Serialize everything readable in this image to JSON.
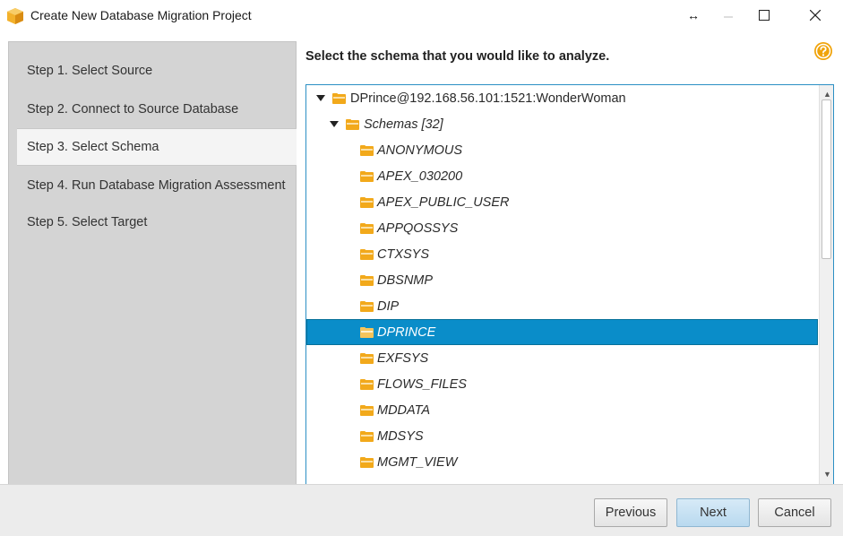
{
  "window": {
    "title": "Create New Database Migration Project",
    "resize_glyph": "↔",
    "app_icon": "cube-icon"
  },
  "steps": [
    {
      "label": "Step 1. Select Source",
      "active": false
    },
    {
      "label": "Step 2. Connect to Source Database",
      "active": false
    },
    {
      "label": "Step 3. Select Schema",
      "active": true
    },
    {
      "label": "Step 4. Run Database Migration Assessment",
      "active": false
    },
    {
      "label": "Step 5. Select Target",
      "active": false
    }
  ],
  "main": {
    "prompt": "Select the schema that you would like to analyze.",
    "help_icon": "help-icon"
  },
  "tree": {
    "root": {
      "label": "DPrince@192.168.56.101:1521:WonderWoman",
      "expanded": true
    },
    "schemas_node": {
      "label": "Schemas [32]",
      "expanded": true
    },
    "schemas": [
      {
        "label": "ANONYMOUS",
        "selected": false
      },
      {
        "label": "APEX_030200",
        "selected": false
      },
      {
        "label": "APEX_PUBLIC_USER",
        "selected": false
      },
      {
        "label": "APPQOSSYS",
        "selected": false
      },
      {
        "label": "CTXSYS",
        "selected": false
      },
      {
        "label": "DBSNMP",
        "selected": false
      },
      {
        "label": "DIP",
        "selected": false
      },
      {
        "label": "DPRINCE",
        "selected": true
      },
      {
        "label": "EXFSYS",
        "selected": false
      },
      {
        "label": "FLOWS_FILES",
        "selected": false
      },
      {
        "label": "MDDATA",
        "selected": false
      },
      {
        "label": "MDSYS",
        "selected": false
      },
      {
        "label": "MGMT_VIEW",
        "selected": false
      }
    ]
  },
  "footer": {
    "previous_label": "Previous",
    "next_label": "Next",
    "cancel_label": "Cancel"
  },
  "colors": {
    "selection": "#0a8dc9",
    "folder": "#f2a91b",
    "help": "#f0a30a",
    "panel": "#d4d4d4"
  }
}
